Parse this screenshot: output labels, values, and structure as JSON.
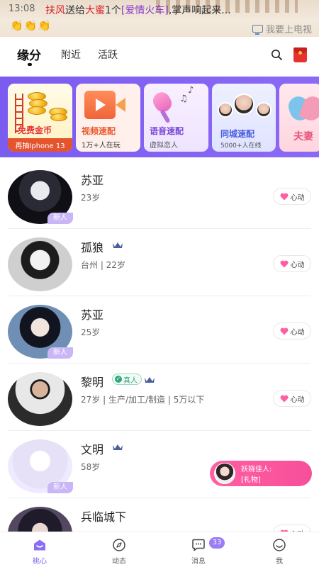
{
  "status_bar": {
    "time": "13:08"
  },
  "broadcast": {
    "sender": "扶风",
    "verb": "送给",
    "receiver": "大蜜",
    "count": "1个",
    "gift": "[爱情火车]",
    "tail": ",掌声响起来...",
    "claps": "👏👏👏",
    "tv_link": "我要上电视"
  },
  "header": {
    "tabs": [
      {
        "label": "缘分",
        "active": true
      },
      {
        "label": "附近",
        "active": false
      },
      {
        "label": "活跃",
        "active": false
      }
    ]
  },
  "features": [
    {
      "title": "免费金币",
      "subtitle": "再抽Iphone 13"
    },
    {
      "title": "视频速配",
      "subtitle": "1万+人在玩"
    },
    {
      "title": "语音速配",
      "subtitle": "虚拟恋人"
    },
    {
      "title": "同城速配",
      "subtitle": "5000+人在线"
    },
    {
      "title": "夫妻"
    }
  ],
  "users": [
    {
      "name": "苏亚",
      "info": "23岁",
      "new_badge": "新人",
      "action": "心动"
    },
    {
      "name": "孤狼",
      "info": "台州 | 22岁",
      "action": "心动"
    },
    {
      "name": "苏亚",
      "info": "25岁",
      "new_badge": "新人",
      "action": "心动"
    },
    {
      "name": "黎明",
      "verified": "真人",
      "info": "27岁 | 生产/加工/制造 | 5万以下",
      "action": "心动"
    },
    {
      "name": "文明",
      "info": "58岁",
      "new_badge": "新人"
    },
    {
      "name": "兵临城下",
      "info": "",
      "action": "心动"
    }
  ],
  "gift_toast": {
    "name": "妖娆佳人:",
    "message": "[礼物]"
  },
  "bottom_nav": [
    {
      "label": "桃心",
      "icon": "home-icon",
      "active": true
    },
    {
      "label": "动态",
      "icon": "compass-icon"
    },
    {
      "label": "消息",
      "icon": "message-icon",
      "badge": "33"
    },
    {
      "label": "我",
      "icon": "profile-icon"
    }
  ],
  "colors": {
    "accent": "#7b5cf0",
    "heart": "#ff5fa2",
    "alert": "#d8242a"
  }
}
